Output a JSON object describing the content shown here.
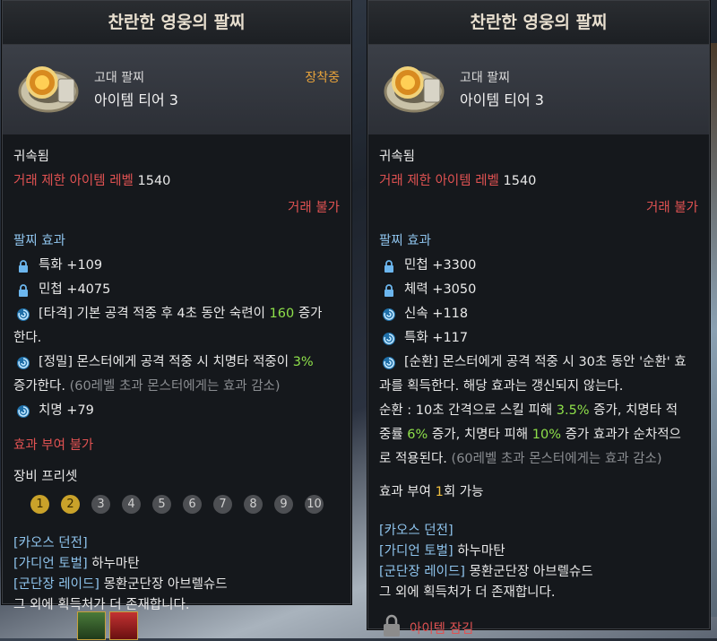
{
  "left": {
    "title": "찬란한 영웅의 팔찌",
    "category": "고대 팔찌",
    "tier": "아이템 티어 3",
    "equipped": "장착중",
    "bound": "귀속됨",
    "trade_level_label": "거래 제한 아이템 레벨",
    "trade_level_value": "1540",
    "trade_status": "거래 불가",
    "effects_header": "팔찌 효과",
    "stats": [
      {
        "icon": "lock-icon",
        "text": "특화 +109"
      },
      {
        "icon": "lock-icon",
        "text": "민첩 +4075"
      }
    ],
    "effect1": {
      "tag": "[타격]",
      "pre": " 기본 공격 적중 후 4초 동안 숙련이 ",
      "num": "160",
      "post": " 증가",
      "line2": "한다."
    },
    "effect2": {
      "tag": "[정밀]",
      "pre": " 몬스터에게 공격 적중 시 치명타 적중이 ",
      "num": "3%",
      "line2": "증가한다.",
      "note": " (60레벨 초과 몬스터에게는 효과 감소)"
    },
    "stat_crit": "치명 +79",
    "grant": "효과 부여 불가",
    "preset_label": "장비 프리셋",
    "presets": [
      "1",
      "2",
      "3",
      "4",
      "5",
      "6",
      "7",
      "8",
      "9",
      "10"
    ],
    "sources": [
      "[카오스 던전]",
      "[가디언 토벌] 하누마탄",
      "[군단장 레이드] 몽환군단장 아브렐슈드",
      "그 외에 획득처가 더 존재합니다."
    ]
  },
  "right": {
    "title": "찬란한 영웅의 팔찌",
    "category": "고대 팔찌",
    "tier": "아이템 티어 3",
    "bound": "귀속됨",
    "trade_level_label": "거래 제한 아이템 레벨",
    "trade_level_value": "1540",
    "trade_status": "거래 불가",
    "effects_header": "팔찌 효과",
    "stats": [
      {
        "icon": "lock-icon",
        "text": "민첩 +3300"
      },
      {
        "icon": "lock-icon",
        "text": "체력 +3050"
      },
      {
        "icon": "swirl-icon",
        "text": "신속 +118"
      },
      {
        "icon": "swirl-icon",
        "text": "특화 +117"
      }
    ],
    "effect": {
      "tag": "[순환]",
      "l1": " 몬스터에게 공격 적중 시 30초 동안 '순환' 효",
      "l2": "과를 획득한다. 해당 효과는 갱신되지 않는다.",
      "l3a": "순환 : 10초 간격으로 스킬 피해 ",
      "n1": "3.5%",
      "l3b": " 증가, 치명타 적",
      "l4a": "중률 ",
      "n2": "6%",
      "l4b": " 증가, 치명타 피해 ",
      "n3": "10%",
      "l4c": " 증가 효과가 순차적으",
      "l5": "로 적용된다.",
      "note": " (60레벨 초과 몬스터에게는 효과 감소)"
    },
    "grant_pre": "효과 부여 ",
    "grant_num": "1",
    "grant_post": "회 가능",
    "sources": [
      "[카오스 던전]",
      "[가디언 토벌] 하누마탄",
      "[군단장 레이드] 몽환군단장 아브렐슈드",
      "그 외에 획득처가 더 존재합니다."
    ],
    "locked": "아이템 잠김"
  },
  "colors": {
    "accent": "#e8a33b",
    "red": "#e05252",
    "green": "#8ee04a",
    "blue": "#8ec3ec"
  }
}
